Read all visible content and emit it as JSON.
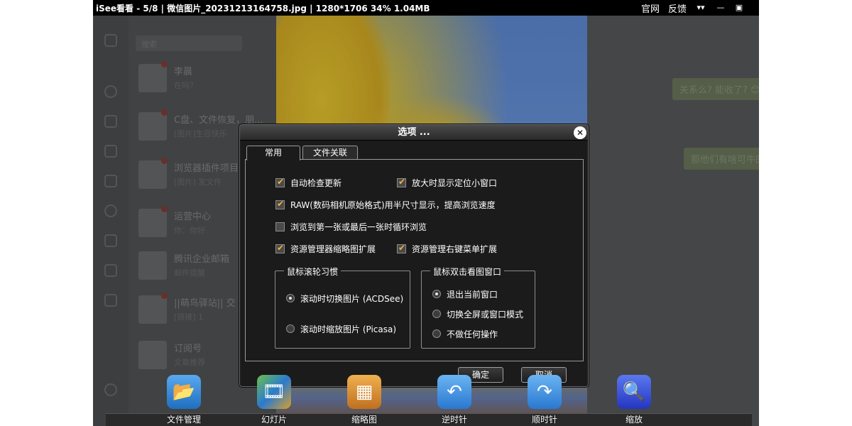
{
  "window": {
    "title": "iSee看看 - 5/8 | 微信图片_20231213164758.jpg | 1280*1706  34%  1.04MB",
    "links": [
      "官网",
      "反馈"
    ],
    "buttons": [
      "expand-icon",
      "minimize-icon",
      "maximize-icon"
    ]
  },
  "background_chat": {
    "search_placeholder": "搜索",
    "items": [
      {
        "name": "李晨",
        "sub": "在吗？"
      },
      {
        "name": "C盘、文件恢复，朋...",
        "sub": "[图片]生日快乐"
      },
      {
        "name": "浏览器插件项目",
        "sub": "[图片] 发文件"
      },
      {
        "name": "运营中心",
        "sub": "你：你好"
      },
      {
        "name": "腾讯企业邮箱",
        "sub": "邮件提醒"
      },
      {
        "name": "||萌鸟驿站|| 交",
        "sub": "[链接] 1"
      },
      {
        "name": "订阅号",
        "sub": "文章推荐"
      }
    ],
    "bubbles": [
      "关系么? 能收了? 😊",
      "那他们有啥可牛的"
    ]
  },
  "dialog": {
    "title": "选项 ...",
    "tabs": [
      "常用",
      "文件关联"
    ],
    "checkboxes": [
      {
        "label": "自动检查更新",
        "checked": true
      },
      {
        "label": "放大时显示定位小窗口",
        "checked": true
      },
      {
        "label": "RAW(数码相机原始格式)用半尺寸显示，提高浏览速度",
        "checked": true
      },
      {
        "label": "浏览到第一张或最后一张时循环浏览",
        "checked": false
      },
      {
        "label": "资源管理器缩略图扩展",
        "checked": true
      },
      {
        "label": "资源管理右键菜单扩展",
        "checked": true
      }
    ],
    "groups": [
      {
        "legend": "鼠标滚轮习惯",
        "options": [
          {
            "label": "滚动时切换图片 (ACDSee)",
            "selected": true
          },
          {
            "label": "滚动时缩放图片 (Picasa)",
            "selected": false
          }
        ]
      },
      {
        "legend": "鼠标双击看图窗口",
        "options": [
          {
            "label": "退出当前窗口",
            "selected": true
          },
          {
            "label": "切换全屏或窗口模式",
            "selected": false
          },
          {
            "label": "不做任何操作",
            "selected": false
          }
        ]
      }
    ],
    "ok_label": "确定",
    "cancel_label": "取消",
    "check_mark": "✔"
  },
  "toolbar": {
    "items": [
      {
        "label": "文件管理",
        "icon": "folder-icon",
        "color": "#2f86d8"
      },
      {
        "label": "幻灯片",
        "icon": "filmstrip-icon",
        "color": "#3c8a4a"
      },
      {
        "label": "缩略图",
        "icon": "thumbnails-icon",
        "color": "#d98a2a"
      },
      {
        "label": "逆时针",
        "icon": "rotate-ccw-icon",
        "color": "#2f86d8"
      },
      {
        "label": "顺时针",
        "icon": "rotate-cw-icon",
        "color": "#2f86d8"
      },
      {
        "label": "缩放",
        "icon": "zoom-icon",
        "color": "#3a4fd6"
      }
    ]
  }
}
